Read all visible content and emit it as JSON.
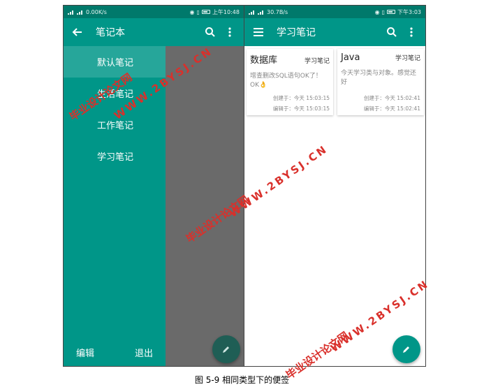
{
  "left_phone": {
    "status": {
      "left": "0.00K/s",
      "right": "上午10:48"
    },
    "appbar": {
      "title": "笔记本",
      "back_icon": "arrow-back-icon",
      "search_icon": "search-icon",
      "more_icon": "more-vert-icon"
    },
    "drawer": {
      "items": [
        {
          "label": "默认笔记"
        },
        {
          "label": "生活笔记"
        },
        {
          "label": "工作笔记"
        },
        {
          "label": "学习笔记"
        }
      ],
      "edit_label": "编辑",
      "exit_label": "退出"
    },
    "fab_icon": "pencil-icon"
  },
  "right_phone": {
    "status": {
      "left": "30.7B/s",
      "right": "下午3:03"
    },
    "appbar": {
      "title": "学习笔记",
      "menu_icon": "menu-icon",
      "search_icon": "search-icon",
      "more_icon": "more-vert-icon"
    },
    "notes": [
      {
        "title": "数据库",
        "tag": "学习笔记",
        "content": "增查删改SQL语句OK了！OK👌",
        "created": "创建于：今天  15:03:15",
        "edited": "编辑于：今天  15:03:15"
      },
      {
        "title": "Java",
        "tag": "学习笔记",
        "content": "今天学习类与对象。感觉还好",
        "created": "创建于：今天  15:02:41",
        "edited": "编辑于：今天  15:02:41"
      }
    ],
    "fab_icon": "pencil-icon"
  },
  "caption": "图 5-9  相同类型下的便签",
  "watermark": {
    "text": "毕业设计论文网",
    "url": "WWW.2BYSJ.CN"
  },
  "colors": {
    "primary": "#009688",
    "primary_dark": "#00796b",
    "drawer_active": "#26a69a",
    "scrim": "#6a6a6a",
    "fab_right": "#009688",
    "fab_left": "#1f5e55",
    "watermark": "#d9302b"
  }
}
